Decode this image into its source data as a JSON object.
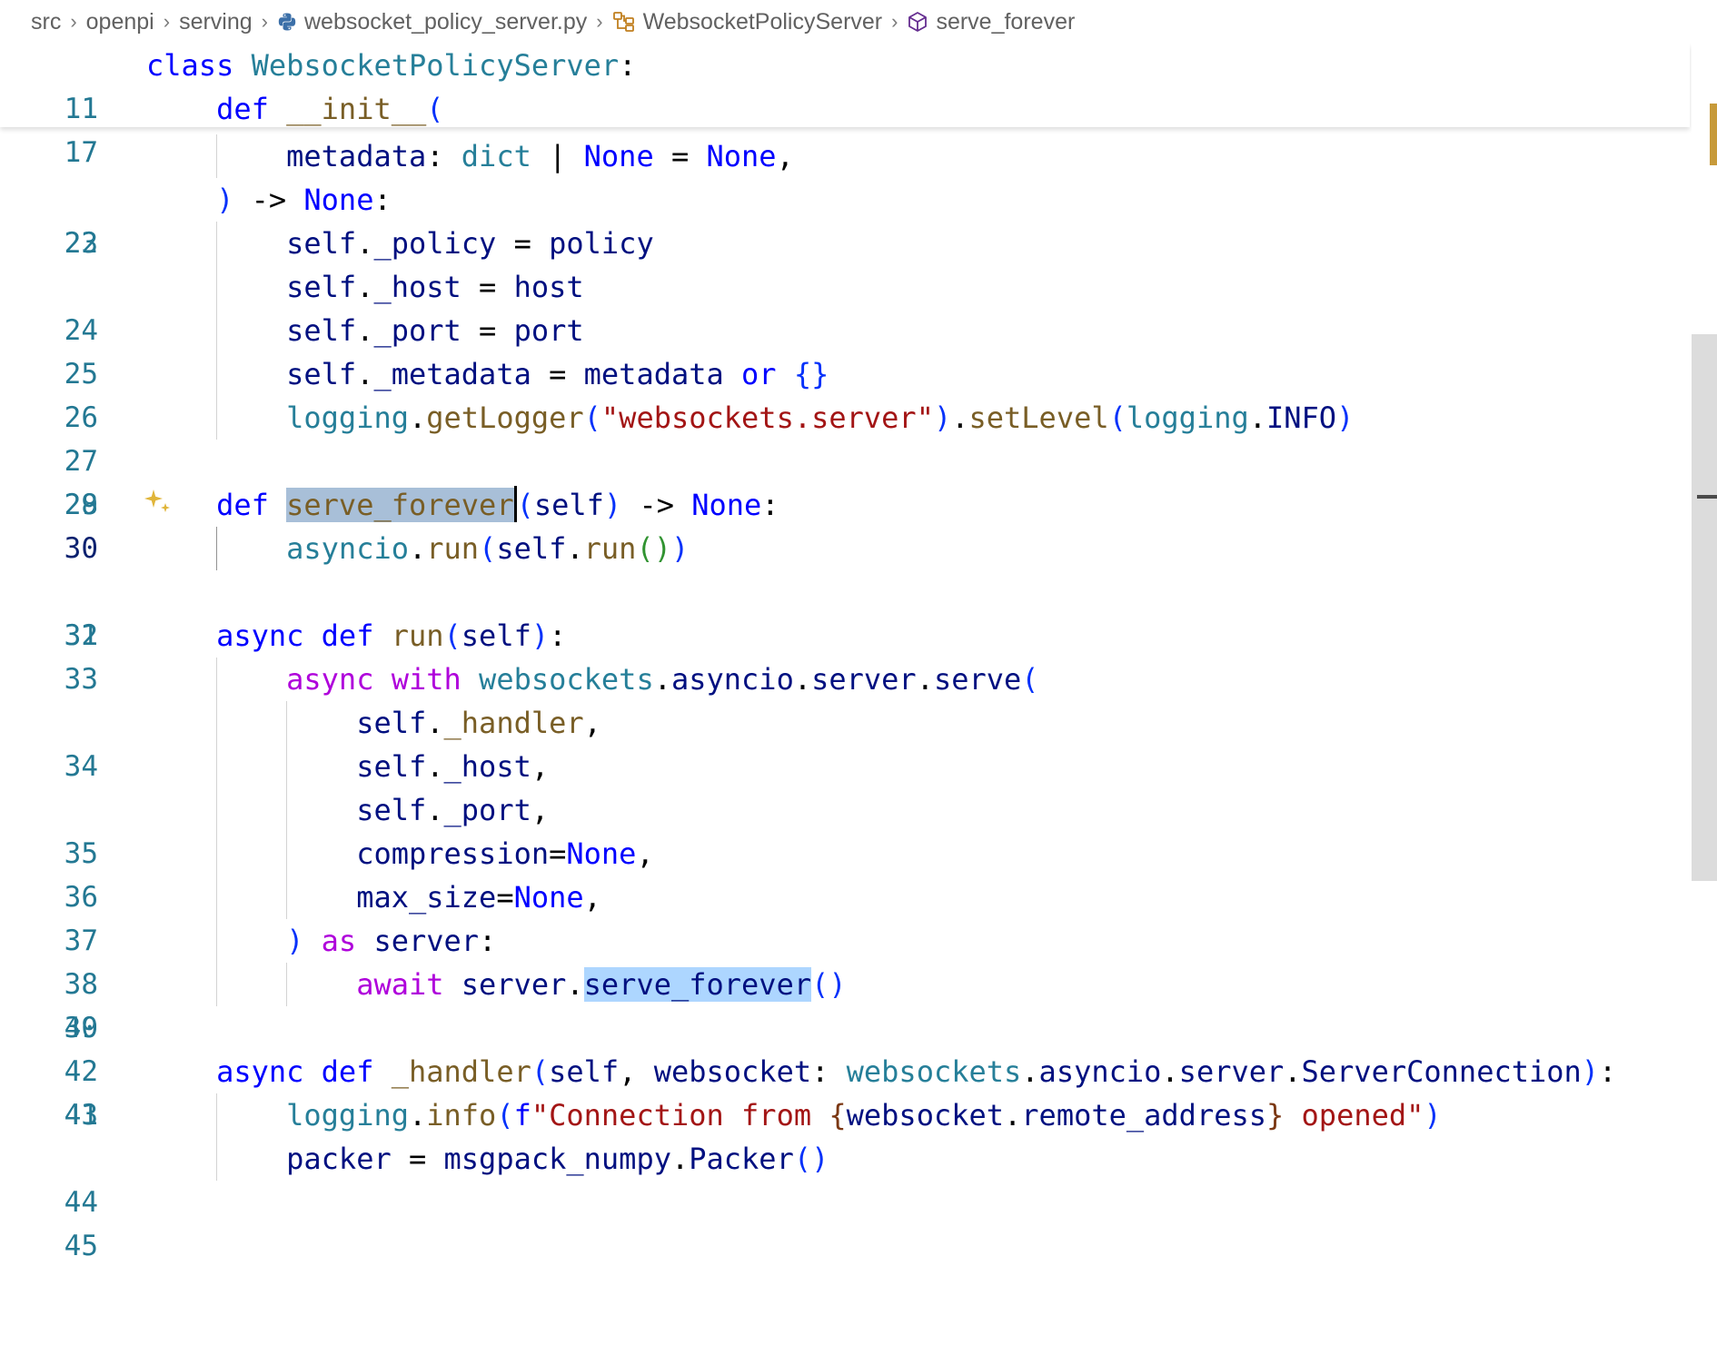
{
  "breadcrumb": {
    "items": [
      {
        "label": "src",
        "icon": null
      },
      {
        "label": "openpi",
        "icon": null
      },
      {
        "label": "serving",
        "icon": null
      },
      {
        "label": "websocket_policy_server.py",
        "icon": "python-file-icon"
      },
      {
        "label": "WebsocketPolicyServer",
        "icon": "class-symbol-icon"
      },
      {
        "label": "serve_forever",
        "icon": "method-symbol-icon"
      }
    ],
    "separator": "›"
  },
  "colors": {
    "keyword": "#0000ff",
    "control_keyword": "#af00db",
    "function": "#795e26",
    "class": "#267f99",
    "string": "#a31515",
    "variable": "#001080",
    "line_number": "#237893",
    "active_line_number": "#0b216f",
    "selection": "#add6ff",
    "sparkle": "#e0b53a",
    "overview_marker": "#c79a3a"
  },
  "editor": {
    "language": "python",
    "cursor_line": 30,
    "selected_word": "serve_forever",
    "sticky_lines": [
      {
        "number": "11",
        "code": "class WebsocketPolicyServer:"
      },
      {
        "number": "17",
        "code": "    def __init__("
      }
    ],
    "lines": [
      {
        "number": "22",
        "code": "        metadata: dict | None = None,"
      },
      {
        "number": "23",
        "code": "    ) -> None:"
      },
      {
        "number": "24",
        "code": "        self._policy = policy"
      },
      {
        "number": "25",
        "code": "        self._host = host"
      },
      {
        "number": "26",
        "code": "        self._port = port"
      },
      {
        "number": "27",
        "code": "        self._metadata = metadata or {}"
      },
      {
        "number": "28",
        "code": "        logging.getLogger(\"websockets.server\").setLevel(logging.INFO)"
      },
      {
        "number": "29",
        "code": ""
      },
      {
        "number": "30",
        "code": "    def serve_forever(self) -> None:"
      },
      {
        "number": "31",
        "code": "        asyncio.run(self.run())"
      },
      {
        "number": "32",
        "code": ""
      },
      {
        "number": "33",
        "code": "    async def run(self):"
      },
      {
        "number": "34",
        "code": "        async with websockets.asyncio.server.serve("
      },
      {
        "number": "35",
        "code": "            self._handler,"
      },
      {
        "number": "36",
        "code": "            self._host,"
      },
      {
        "number": "37",
        "code": "            self._port,"
      },
      {
        "number": "38",
        "code": "            compression=None,"
      },
      {
        "number": "39",
        "code": "            max_size=None,"
      },
      {
        "number": "40",
        "code": "        ) as server:"
      },
      {
        "number": "41",
        "code": "            await server.serve_forever()"
      },
      {
        "number": "42",
        "code": ""
      },
      {
        "number": "43",
        "code": "    async def _handler(self, websocket: websockets.asyncio.server.ServerConnection):"
      },
      {
        "number": "44",
        "code": "        logging.info(f\"Connection from {websocket.remote_address} opened\")"
      },
      {
        "number": "45",
        "code": "        packer = msgpack_numpy.Packer()"
      }
    ]
  }
}
